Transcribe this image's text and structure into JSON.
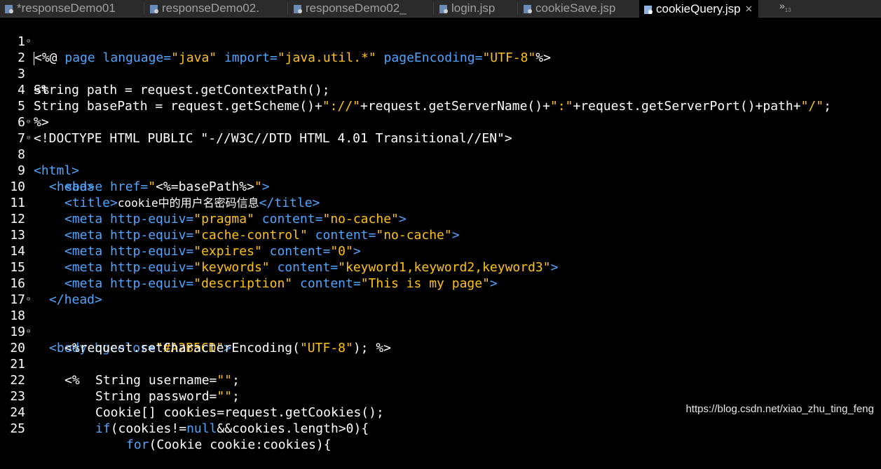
{
  "tabs": [
    {
      "label": "*responseDemo01",
      "active": false
    },
    {
      "label": "responseDemo02.",
      "active": false
    },
    {
      "label": "responseDemo02_",
      "active": false
    },
    {
      "label": "login.jsp",
      "active": false
    },
    {
      "label": "cookieSave.jsp",
      "active": false
    },
    {
      "label": "cookieQuery.jsp",
      "active": true
    }
  ],
  "tab_overflow": {
    "symbol": "»",
    "count": "13"
  },
  "lines": [
    {
      "n": "1"
    },
    {
      "n": "2"
    },
    {
      "n": "3"
    },
    {
      "n": "4"
    },
    {
      "n": "5"
    },
    {
      "n": "6"
    },
    {
      "n": "7"
    },
    {
      "n": "8"
    },
    {
      "n": "9"
    },
    {
      "n": "10"
    },
    {
      "n": "11"
    },
    {
      "n": "12"
    },
    {
      "n": "13"
    },
    {
      "n": "14"
    },
    {
      "n": "15"
    },
    {
      "n": "16"
    },
    {
      "n": "17"
    },
    {
      "n": "18"
    },
    {
      "n": "19"
    },
    {
      "n": "20"
    },
    {
      "n": "21"
    },
    {
      "n": "22"
    },
    {
      "n": "23"
    },
    {
      "n": "24"
    },
    {
      "n": "25"
    }
  ],
  "code": {
    "l1": {
      "a": "<%@ ",
      "b": "page",
      "c": " language=",
      "d": "\"java\"",
      "e": " import=",
      "f": "\"java.util.*\"",
      "g": " pageEncoding=",
      "h": "\"UTF-8\"",
      "i": "%>"
    },
    "l2": "<%",
    "l3": "String path = request.getContextPath();",
    "l4": {
      "a": "String basePath = request.getScheme()+",
      "b": "\"://\"",
      "c": "+request.getServerName()+",
      "d": "\":\"",
      "e": "+request.getServerPort()+path+",
      "f": "\"/\"",
      "g": ";"
    },
    "l5": "%>",
    "l6": "<!DOCTYPE HTML PUBLIC \"-//W3C//DTD HTML 4.01 Transitional//EN\">",
    "l7": "<html>",
    "l8": "<head>",
    "l9": {
      "a": "<base ",
      "b": "href=",
      "c": "\"",
      "d": "<%=basePath%>",
      "e": "\"",
      "f": ">"
    },
    "l10": {
      "a": "<title>",
      "b": "cookie中的用户名密码信息",
      "c": "</title>"
    },
    "l11": {
      "a": "<meta ",
      "b": "http-equiv=",
      "c": "\"pragma\"",
      "d": " content=",
      "e": "\"no-cache\"",
      "f": ">"
    },
    "l12": {
      "a": "<meta ",
      "b": "http-equiv=",
      "c": "\"cache-control\"",
      "d": " content=",
      "e": "\"no-cache\"",
      "f": ">"
    },
    "l13": {
      "a": "<meta ",
      "b": "http-equiv=",
      "c": "\"expires\"",
      "d": " content=",
      "e": "\"0\"",
      "f": ">"
    },
    "l14": {
      "a": "<meta ",
      "b": "http-equiv=",
      "c": "\"keywords\"",
      "d": " content=",
      "e": "\"keyword1,keyword2,keyword3\"",
      "f": ">"
    },
    "l15": {
      "a": "<meta ",
      "b": "http-equiv=",
      "c": "\"description\"",
      "d": " content=",
      "e": "\"This is my page\"",
      "f": ">"
    },
    "l16": "</head>",
    "l18": {
      "a": "<body ",
      "b": "bgcolor=",
      "c": "\"#A2B5CD\"",
      "d": ">"
    },
    "l19": {
      "a": "<%",
      "b": "request.setCharacterEncoding(",
      "c": "\"UTF-8\"",
      "d": "); %>"
    },
    "l20": "<%",
    "l21": {
      "a": "String username=",
      "b": "\"\"",
      "c": ";"
    },
    "l22": {
      "a": "String password=",
      "b": "\"\"",
      "c": ";"
    },
    "l23": "Cookie[] cookies=request.getCookies();",
    "l24": {
      "a": "if",
      "b": "(cookies!=",
      "c": "null",
      "d": "&&cookies.length>0){"
    },
    "l25": {
      "a": "for",
      "b": "(Cookie cookie:cookies){"
    }
  },
  "watermark": "https://blog.csdn.net/xiao_zhu_ting_feng",
  "colors": {
    "background": "#000000",
    "tag": "#4fa5ff",
    "string": "#ffc20e",
    "keyword": "#ff7ad9",
    "text": "#ffffff"
  }
}
